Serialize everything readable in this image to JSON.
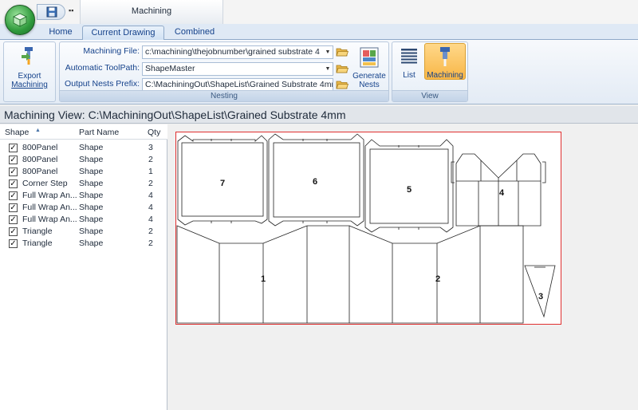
{
  "window": {
    "title": "Machining"
  },
  "tabs": [
    {
      "label": "Home",
      "active": false
    },
    {
      "label": "Current Drawing",
      "active": true
    },
    {
      "label": "Combined",
      "active": false
    }
  ],
  "ribbon": {
    "export_button": {
      "line1": "Export",
      "line2": "Machining",
      "icon": "export-machining-icon"
    },
    "nesting": {
      "label": "Nesting",
      "machining_file_label": "Machining File:",
      "machining_file_value": "c:\\machining\\thejobnumber\\grained substrate 4",
      "toolpath_label": "Automatic ToolPath:",
      "toolpath_value": "ShapeMaster",
      "prefix_label": "Output Nests Prefix:",
      "prefix_value": "C:\\MachiningOut\\ShapeList\\Grained Substrate 4mm",
      "generate_line1": "Generate",
      "generate_line2": "Nests"
    },
    "view": {
      "label": "View",
      "list_label": "List",
      "machining_label": "Machining"
    }
  },
  "view_header": "Machining View: C:\\MachiningOut\\ShapeList\\Grained Substrate 4mm",
  "list": {
    "columns": [
      "Shape",
      "Part Name",
      "Qty"
    ],
    "rows": [
      {
        "shape": "800Panel",
        "part": "Shape",
        "qty": "3"
      },
      {
        "shape": "800Panel",
        "part": "Shape",
        "qty": "2"
      },
      {
        "shape": "800Panel",
        "part": "Shape",
        "qty": "1"
      },
      {
        "shape": "Corner Step",
        "part": "Shape",
        "qty": "2"
      },
      {
        "shape": "Full Wrap An...",
        "part": "Shape",
        "qty": "4"
      },
      {
        "shape": "Full Wrap An...",
        "part": "Shape",
        "qty": "4"
      },
      {
        "shape": "Full Wrap An...",
        "part": "Shape",
        "qty": "4"
      },
      {
        "shape": "Triangle",
        "part": "Shape",
        "qty": "2"
      },
      {
        "shape": "Triangle",
        "part": "Shape",
        "qty": "2"
      }
    ]
  },
  "nest": {
    "part_labels": [
      "7",
      "6",
      "5",
      "4",
      "1",
      "2",
      "3"
    ],
    "border_color": "#e03030"
  },
  "colors": {
    "accent": "#15428b",
    "selected": "#f8b646"
  }
}
